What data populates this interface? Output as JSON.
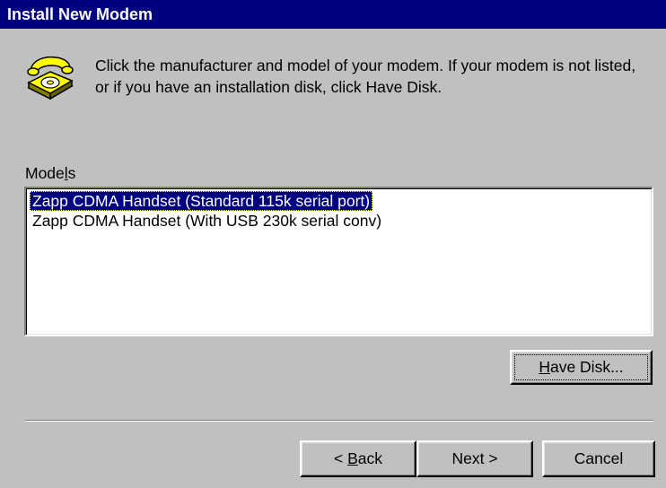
{
  "window": {
    "title": "Install New Modem"
  },
  "instructions": {
    "line1": "Click the manufacturer and model of your modem. If your modem is not listed,",
    "line2": "or if you have an installation disk, click Have Disk."
  },
  "models": {
    "label_pre": "Mode",
    "label_accel": "l",
    "label_post": "s",
    "items": [
      {
        "label": "Zapp CDMA Handset (Standard 115k serial port)",
        "selected": true
      },
      {
        "label": "Zapp CDMA Handset (With USB 230k serial conv)",
        "selected": false
      }
    ]
  },
  "buttons": {
    "have_disk_accel": "H",
    "have_disk_rest": "ave Disk...",
    "back_prefix": "< ",
    "back_accel": "B",
    "back_rest": "ack",
    "next": "Next >",
    "cancel": "Cancel"
  },
  "icons": {
    "header": "telephone-icon"
  },
  "colors": {
    "titlebar": "#000080",
    "dialog": "#c0c0c0",
    "selection": "#000080",
    "phone": "#ffff00"
  }
}
